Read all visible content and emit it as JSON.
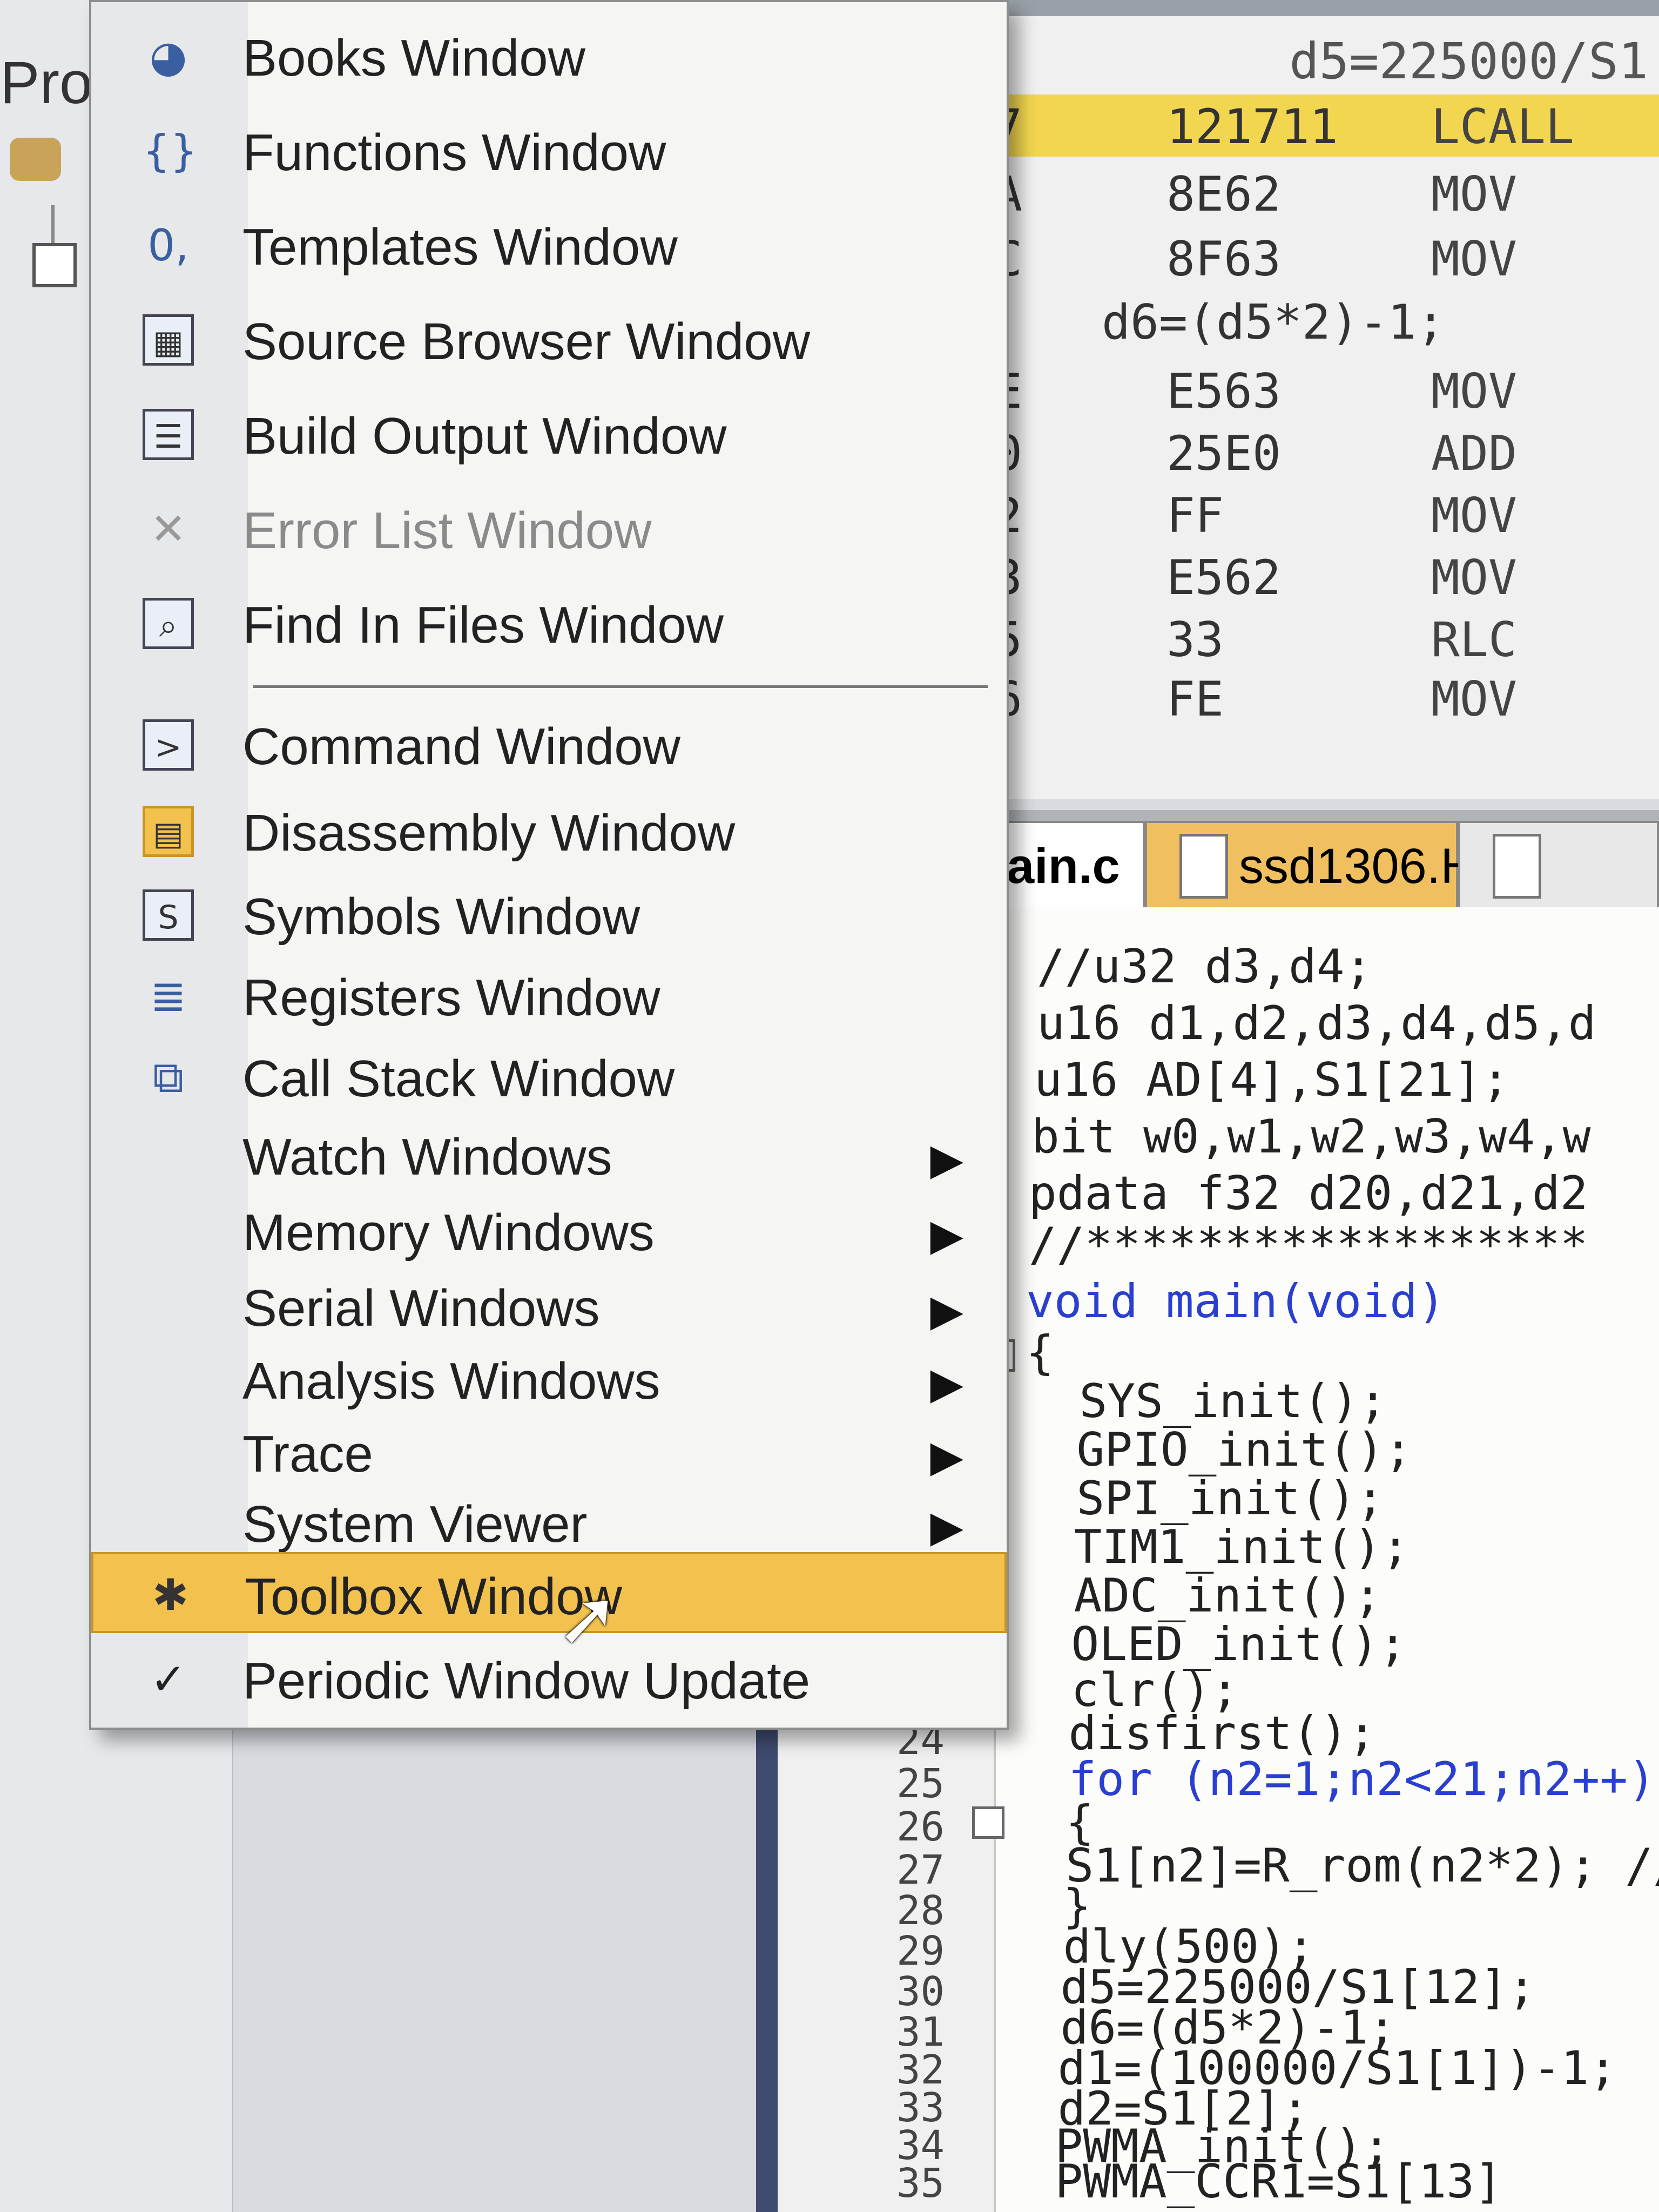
{
  "left_panel": {
    "title": "Pro"
  },
  "disassembly": {
    "top_source": "d5=225000/S1",
    "rows": [
      {
        "addr": "7",
        "op": "121711",
        "mn": "LCALL",
        "highlight": true
      },
      {
        "addr": "A",
        "op": "8E62",
        "mn": "MOV"
      },
      {
        "addr": "C",
        "op": "8F63",
        "mn": "MOV"
      },
      {
        "addr": "E",
        "op": "E563",
        "mn": "MOV"
      },
      {
        "addr": "0",
        "op": "25E0",
        "mn": "ADD"
      },
      {
        "addr": "2",
        "op": "FF",
        "mn": "MOV"
      },
      {
        "addr": "3",
        "op": "E562",
        "mn": "MOV"
      },
      {
        "addr": "5",
        "op": "33",
        "mn": "RLC"
      },
      {
        "addr": "6",
        "op": "FE",
        "mn": "MOV"
      }
    ],
    "source_line": "d6=(d5*2)-1;"
  },
  "tabs": {
    "main": "ain.c",
    "ssd": "ssd1306.H"
  },
  "editor": {
    "lines": [
      "//u32 d3,d4;",
      "u16 d1,d2,d3,d4,d5,d",
      "u16 AD[4],S1[21];",
      "bit w0,w1,w2,w3,w4,w",
      "pdata f32 d20,d21,d2",
      "//******************",
      "void main(void)",
      "{",
      "  SYS_init();",
      "  GPIO_init();",
      "  SPI_init();",
      "  TIM1_init();",
      "  ADC_init();",
      "  OLED_init();",
      "  clr();",
      "  disfirst();",
      "  for (n2=1;n2<21;n2++)",
      "  {",
      "  S1[n2]=R_rom(n2*2); //",
      "  }",
      "  dly(500);",
      "  d5=225000/S1[12];",
      "  d6=(d5*2)-1;",
      "  d1=(100000/S1[1])-1;",
      "  d2=S1[2];",
      "  PWMA_init();",
      "  PWMA_CCR1=S1[13]"
    ],
    "line_numbers": [
      "24",
      "25",
      "26",
      "27",
      "28",
      "29",
      "30",
      "31",
      "32",
      "33",
      "34",
      "35"
    ]
  },
  "menu": {
    "items": [
      {
        "label": "Books Window",
        "icon": "books-icon",
        "glyph": "◕"
      },
      {
        "label": "Functions Window",
        "icon": "functions-icon",
        "glyph": "{}"
      },
      {
        "label": "Templates Window",
        "icon": "templates-icon",
        "glyph": "0,"
      },
      {
        "label": "Source Browser Window",
        "icon": "source-browser-icon",
        "glyph": "▦"
      },
      {
        "label": "Build Output Window",
        "icon": "build-output-icon",
        "glyph": "☰"
      },
      {
        "label": "Error List Window",
        "icon": "error-list-icon",
        "glyph": "✕",
        "disabled": true
      },
      {
        "label": "Find In Files Window",
        "icon": "find-in-files-icon",
        "glyph": "⌕"
      },
      {
        "label": "Command Window",
        "icon": "command-icon",
        "glyph": ">"
      },
      {
        "label": "Disassembly Window",
        "icon": "disassembly-icon",
        "glyph": "▤"
      },
      {
        "label": "Symbols Window",
        "icon": "symbols-icon",
        "glyph": "S"
      },
      {
        "label": "Registers Window",
        "icon": "registers-icon",
        "glyph": "≣"
      },
      {
        "label": "Call Stack Window",
        "icon": "call-stack-icon",
        "glyph": "⧉"
      },
      {
        "label": "Watch Windows",
        "submenu": true
      },
      {
        "label": "Memory Windows",
        "submenu": true
      },
      {
        "label": "Serial Windows",
        "submenu": true
      },
      {
        "label": "Analysis Windows",
        "submenu": true
      },
      {
        "label": "Trace",
        "submenu": true
      },
      {
        "label": "System Viewer",
        "submenu": true
      },
      {
        "label": "Toolbox Window",
        "icon": "toolbox-icon",
        "glyph": "✱",
        "highlight": true
      },
      {
        "label": "Periodic Window Update",
        "icon": "checkmark-icon",
        "glyph": "✓"
      }
    ],
    "submenu_arrow": "▶"
  },
  "colors": {
    "highlight": "#f2c14e",
    "menu_bg": "#f5f5f3",
    "keyword": "#2a3fd0"
  }
}
